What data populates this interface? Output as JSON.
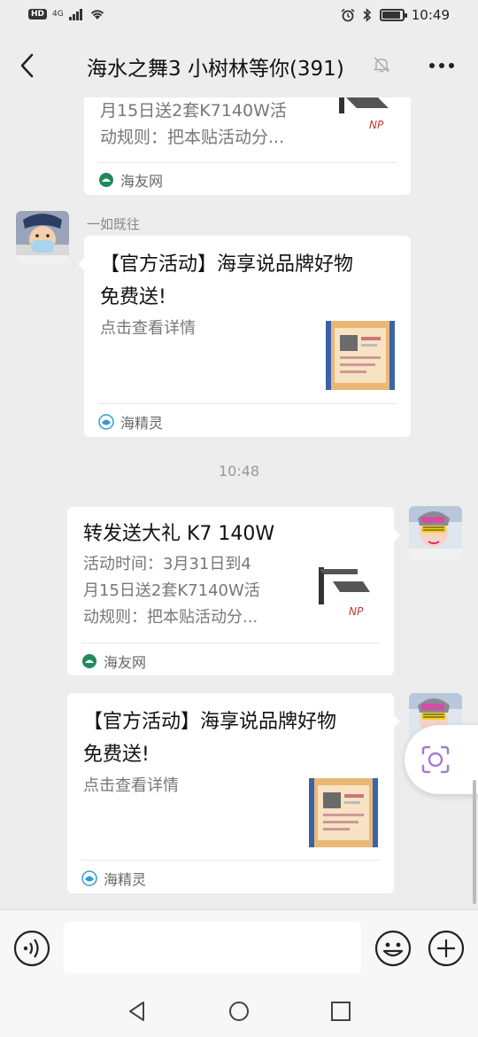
{
  "status_bar": {
    "hd": "HD",
    "network": "4G",
    "time": "10:49",
    "battery_level": 0.85
  },
  "header": {
    "title": "海水之舞3 小树林等你(391)"
  },
  "messages": {
    "card_top_partial": {
      "line1": "月15日送2套K7140W活",
      "line2": "动规则：把本贴活动分...",
      "source": "海友网"
    },
    "sender_name": "一如既往",
    "card_official_left": {
      "title_line1": "【官方活动】海享说品牌好物",
      "title_line2": "免费送!",
      "desc": "点击查看详情",
      "source": "海精灵"
    },
    "timestamp": "10:48",
    "card_forward_right": {
      "title": "转发送大礼 K7 140W",
      "desc_line1": "活动时间：3月31日到4",
      "desc_line2": "月15日送2套K7140W活",
      "desc_line3": "动规则：把本贴活动分...",
      "source": "海友网"
    },
    "card_official_right": {
      "title_line1": "【官方活动】海享说品牌好物",
      "title_line2": "免费送!",
      "desc": "点击查看详情",
      "source": "海精灵"
    }
  },
  "thumb_brand": "NP",
  "colors": {
    "background": "#ededed",
    "bubble": "#ffffff",
    "source_icon_green": "#1f8a5b",
    "source_icon_blue": "#2f9bd6"
  },
  "icons": {
    "back": "chevron-left-icon",
    "mute": "bell-off-icon",
    "more": "more-dots-icon",
    "voice": "voice-icon",
    "emoji": "emoji-icon",
    "plus": "plus-icon",
    "scan": "scan-lens-icon",
    "nav_back": "nav-back-icon",
    "nav_home": "nav-home-icon",
    "nav_recent": "nav-recent-icon"
  }
}
